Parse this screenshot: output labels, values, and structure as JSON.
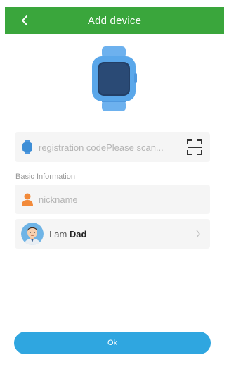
{
  "header": {
    "title": "Add device",
    "back_icon": "chevron-left-icon"
  },
  "device_image": "smartwatch-icon",
  "registration": {
    "placeholder": "registration codePlease scan...",
    "value": "",
    "icon": "watch-icon",
    "scan_icon": "scan-frame-icon"
  },
  "basic_info": {
    "label": "Basic Information"
  },
  "nickname": {
    "placeholder": "nickname",
    "value": "",
    "icon": "person-icon"
  },
  "role": {
    "prefix": "I am ",
    "value": "Dad",
    "avatar": "dad-avatar",
    "chevron": "chevron-right-icon"
  },
  "ok_button": {
    "label": "Ok"
  },
  "colors": {
    "header_bg": "#3aa63c",
    "button_bg": "#2fa6e0",
    "watch_blue": "#5aa7ea",
    "person_orange": "#f28a3a"
  }
}
